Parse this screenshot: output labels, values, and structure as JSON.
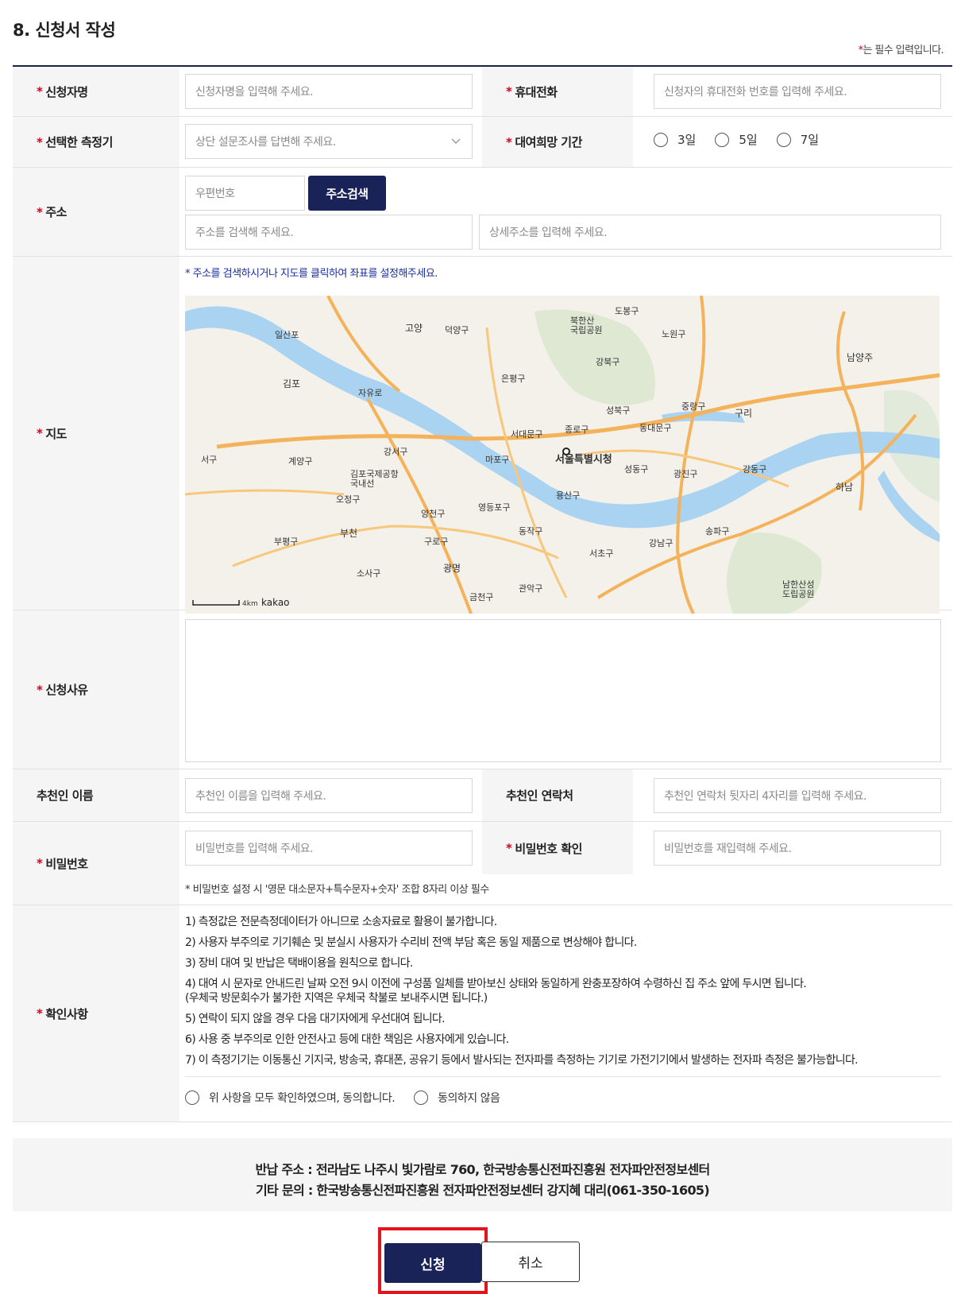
{
  "section_title": "8. 신청서 작성",
  "required_note": "는 필수 입력입니다.",
  "required_mark": "*",
  "fields": {
    "applicant_name": {
      "label": "신청자명",
      "placeholder": "신청자명을 입력해 주세요."
    },
    "mobile": {
      "label": "휴대전화",
      "placeholder": "신청자의 휴대전화 번호를 입력해 주세요."
    },
    "meter": {
      "label": "선택한 측정기",
      "placeholder": "상단 설문조사를 답변해 주세요."
    },
    "rental_period": {
      "label": "대여희망 기간",
      "options": [
        "3일",
        "5일",
        "7일"
      ]
    },
    "address": {
      "label": "주소",
      "zip_placeholder": "우편번호",
      "search_button": "주소검색",
      "address_placeholder": "주소를 검색해 주세요.",
      "detail_placeholder": "상세주소를 입력해 주세요."
    },
    "map": {
      "label": "지도",
      "hint": "* 주소를 검색하시거나 지도를 클릭하여 좌표를 설정해주세요.",
      "places": {
        "seoul": "서울특별시청",
        "goyang": "고양",
        "gimpo": "김포",
        "namyangju": "남양주",
        "guri": "구리",
        "hanam": "하남",
        "gwangmyeong": "광명",
        "bucheon": "부천",
        "bukhansan": "북한산\n국립공원",
        "dobong": "도봉구",
        "nowon": "노원구",
        "gangbuk": "강북구",
        "eunpyeong": "은평구",
        "seongbuk": "성북구",
        "jungnang": "중랑구",
        "jongno": "종로구",
        "seodaemun": "서대문구",
        "mapo": "마포구",
        "dongdaemun": "동대문구",
        "seongdong": "성동구",
        "gwangjin": "광진구",
        "gangdong": "강동구",
        "yongsan": "용산구",
        "yeongdeungpo": "영등포구",
        "dongjak": "동작구",
        "seocho": "서초구",
        "gangnam": "강남구",
        "songpa": "송파구",
        "gangseo": "강서구",
        "yangcheon": "양천구",
        "guro": "구로구",
        "geumcheon": "금천구",
        "gwanak": "관악구",
        "gimpo_airport": "김포국제공항\n국내선",
        "ilsan": "일산포",
        "deogyang": "덕양구",
        "hwajeong": "자유로",
        "gyeyang": "계양구",
        "seogu": "서구",
        "bupyeong": "부평구",
        "sosa": "소사구",
        "ojeong": "오정구",
        "namhansan": "남한산성\n도립공원",
        "scale": "4km",
        "brand": "kakao"
      }
    },
    "reason": {
      "label": "신청사유"
    },
    "recommender_name": {
      "label": "추천인 이름",
      "placeholder": "추천인 이름을 입력해 주세요."
    },
    "recommender_contact": {
      "label": "추천인 연락처",
      "placeholder": "추천인 연락처 뒷자리 4자리를 입력해 주세요."
    },
    "password": {
      "label": "비밀번호",
      "placeholder": "비밀번호를 입력해 주세요.",
      "hint": "* 비밀번호 설정 시 '영문 대소문자+특수문자+숫자' 조합 8자리 이상 필수"
    },
    "password_confirm": {
      "label": "비밀번호 확인",
      "placeholder": "비밀번호를 재입력해 주세요."
    },
    "confirm": {
      "label": "확인사항",
      "items": [
        "1) 측정값은 전문측정데이터가 아니므로 소송자료로 활용이 불가합니다.",
        "2) 사용자 부주의로 기기훼손 및 분실시 사용자가 수리비 전액 부담 혹은 동일 제품으로 변상해야 합니다.",
        "3) 장비 대여 및 반납은 택배이용을 원칙으로 합니다.",
        "4) 대여 시 문자로 안내드린 날짜 오전 9시 이전에 구성품 일체를 받아보신 상태와 동일하게 완충포장하여 수령하신 집 주소 앞에 두시면 됩니다.",
        "(우체국 방문회수가 불가한 지역은 우체국 착불로 보내주시면 됩니다.)",
        "5) 연락이 되지 않을 경우 다음 대기자에게 우선대여 됩니다.",
        "6) 사용 중 부주의로 인한 안전사고 등에 대한 책임은 사용자에게 있습니다.",
        "7) 이 측정기기는 이동통신 기지국, 방송국, 휴대폰, 공유기 등에서 발사되는 전자파를 측정하는 기기로 가전기기에서 발생하는 전자파 측정은 불가능합니다."
      ],
      "agree": "위 사항을 모두 확인하였으며, 동의합니다.",
      "disagree": "동의하지 않음"
    }
  },
  "footer": {
    "return_address": "반납 주소 : 전라남도 나주시 빛가람로 760, 한국방송통신전파진흥원 전자파안전정보센터",
    "contact": "기타 문의 : 한국방송통신전파진흥원 전자파안전정보센터 강지혜 대리(061-350-1605)"
  },
  "buttons": {
    "submit": "신청",
    "cancel": "취소"
  },
  "colors": {
    "navy": "#1a2358",
    "required": "#d0021b",
    "highlight": "#e4131c",
    "hint_blue": "#1a2e9e"
  }
}
